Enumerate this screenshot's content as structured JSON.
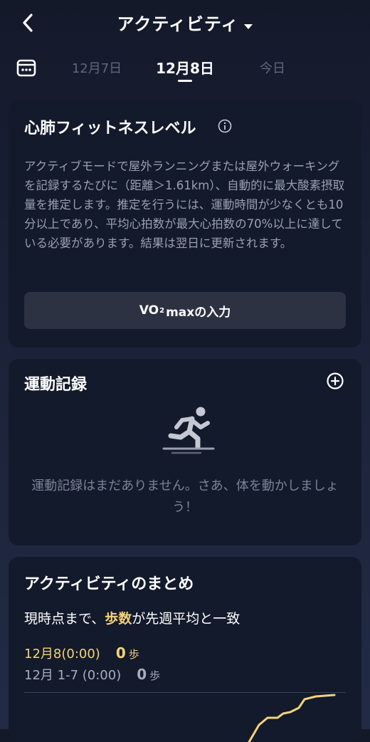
{
  "header": {
    "title": "アクティビティ",
    "back_icon": "back-chevron-icon",
    "caret_icon": "caret-down-icon"
  },
  "date_nav": {
    "calendar_icon": "calendar-icon",
    "prev_date": "12月7日",
    "current_date": "12月8日",
    "next_date": "今日"
  },
  "fitness_card": {
    "title": "心肺フィットネスレベル",
    "info_icon": "info-icon",
    "description": "アクティブモードで屋外ランニングまたは屋外ウォーキングを記録するたびに（距離＞1.61km）、自動的に最大酸素摂取量を推定します。推定を行うには、運動時間が少なくとも10分以上であり、平均心拍数が最大心拍数の70%以上に達している必要があります。結果は翌日に更新されます。",
    "button_prefix": "VO",
    "button_sub": "2",
    "button_suffix": " maxの入力"
  },
  "workout_card": {
    "title": "運動記録",
    "add_icon": "plus-circle-icon",
    "empty_icon": "running-person-icon",
    "empty_text": "運動記録はまだありません。さあ、体を動かしましょう！"
  },
  "summary_card": {
    "title": "アクティビティのまとめ",
    "compare_prefix": "現時点まで、",
    "compare_highlight": "歩数",
    "compare_suffix": "が先週平均と一致",
    "today_label": "12月8(0:00)",
    "today_value": "0",
    "today_unit": "歩",
    "prev_label": "12月 1-7 (0:00)",
    "prev_value": "0",
    "prev_unit": "歩"
  },
  "colors": {
    "accent": "#f3d27a",
    "card_bg": "#131a2b",
    "button_bg": "#2d3242"
  }
}
